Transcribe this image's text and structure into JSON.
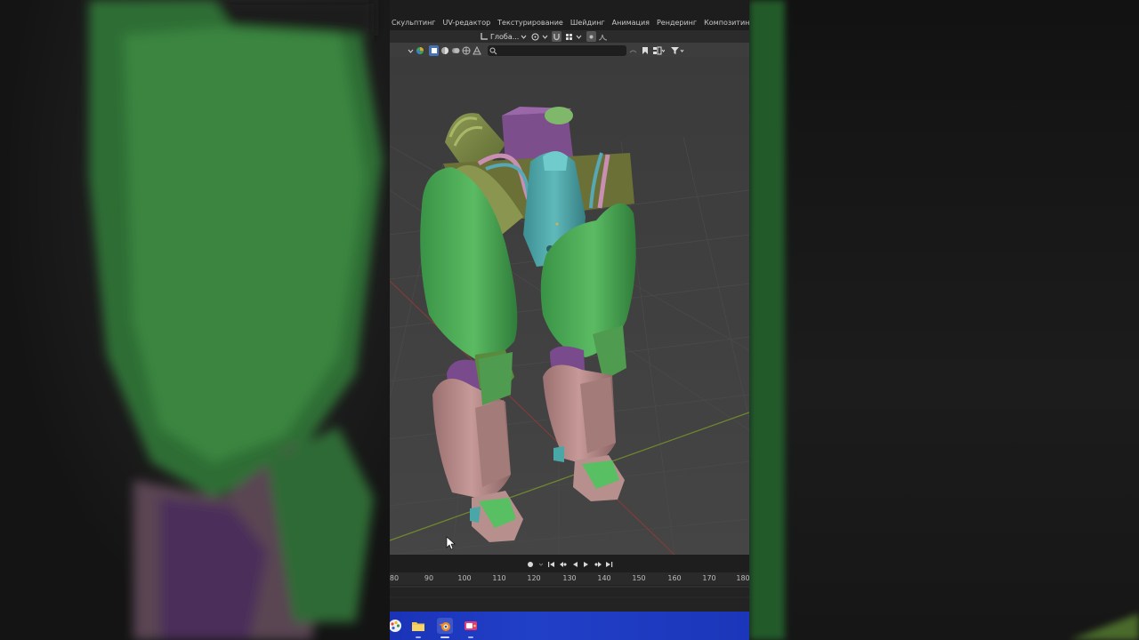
{
  "workspace_tabs": [
    "Скульптинг",
    "UV-редактор",
    "Текстурирование",
    "Шейдинг",
    "Анимация",
    "Рендеринг",
    "Композитинг"
  ],
  "header": {
    "transform_orientation": "Глоба..."
  },
  "timeline": {
    "frame_numbers": [
      "80",
      "90",
      "100",
      "110",
      "120",
      "130",
      "140",
      "150",
      "160",
      "170",
      "180"
    ]
  },
  "taskbar": {
    "apps": [
      "paint-app-icon",
      "file-explorer-icon",
      "blender-icon",
      "camera-app-icon"
    ]
  },
  "colors": {
    "armor_green": "#4aa655",
    "armor_pink": "#b88a88",
    "armor_teal": "#4aa7a7",
    "armor_purple": "#7a4b8c",
    "viewport_bg": "#3f3f3f",
    "taskbar": "#1f3cc2"
  }
}
